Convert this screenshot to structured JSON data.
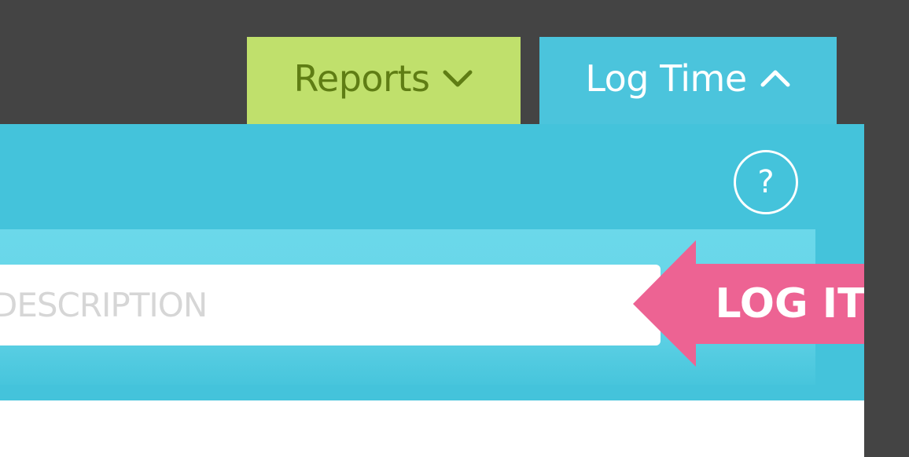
{
  "nav": {
    "reports_label": "Reports",
    "reports_icon": "chevron-down-icon",
    "logtime_label": "Log Time",
    "logtime_icon": "chevron-up-icon"
  },
  "panel": {
    "help_label": "?",
    "description_placeholder": "DESCRIPTION",
    "log_button_label": "LOG IT"
  },
  "colors": {
    "background": "#444444",
    "reports_tab": "#c0e06c",
    "reports_text": "#5f7d14",
    "logtime_tab": "#4bc4dc",
    "panel": "#44c3db",
    "input_band": "#6bd8ea",
    "log_button": "#ed6393",
    "log_button_shadow": "#b8215a"
  }
}
